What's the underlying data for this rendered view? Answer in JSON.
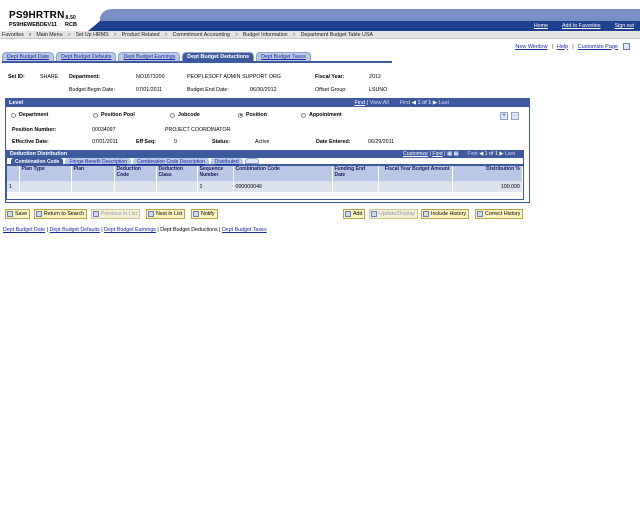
{
  "header": {
    "app_name": "PS9HRTRN",
    "version": "8.50",
    "server": "PS9HEWEBDEV11",
    "user": "RCB",
    "links": [
      "Home",
      "Add to Favorites",
      "Sign out"
    ]
  },
  "menu": [
    "Favorites",
    "Main Menu",
    "Set Up HRMS",
    "Product Related",
    "Commitment Accounting",
    "Budget Information",
    "Department Budget Table USA"
  ],
  "page_links": {
    "new_window": "New Window",
    "help": "Help",
    "customize": "Customize Page"
  },
  "tabs": [
    {
      "label": "Dept Budget Date",
      "active": false
    },
    {
      "label": "Dept Budget Defaults",
      "active": false
    },
    {
      "label": "Dept Budget Earnings",
      "active": false
    },
    {
      "label": "Dept Budget Deductions",
      "active": true
    },
    {
      "label": "Dept Budget Taxes",
      "active": false
    }
  ],
  "fields": {
    "setid_label": "Set ID:",
    "setid": "SHARE",
    "dept_label": "Department:",
    "dept": "NO1673200",
    "dept_name": "PEOPLESOFT ADMIN SUPPORT ORG",
    "fy_label": "Fiscal Year:",
    "fy": "2012",
    "bbd_label": "Budget Begin Date:",
    "bbd": "07/01/2011",
    "bed_label": "Budget End Date:",
    "bed": "06/30/2012",
    "og_label": "Offset Group:",
    "og": "LSUNO"
  },
  "level": {
    "title": "Level",
    "find": "Find",
    "view_all": "View All",
    "first": "First",
    "count": "1 of 1",
    "last": "Last",
    "options": [
      "Department",
      "Position Pool",
      "Jobcode",
      "Position",
      "Appointment"
    ],
    "selected": "Position",
    "posnum_label": "Position Number:",
    "posnum": "00034097",
    "pos_title": "PROJECT COORDINATOR",
    "eff_label": "Effective Date:",
    "eff": "07/01/2011",
    "seq_label": "Eff Seq:",
    "seq": "0",
    "status_label": "Status:",
    "status": "Active",
    "entered_label": "Date Entered:",
    "entered": "06/29/2011"
  },
  "dist": {
    "title": "Deduction Distribution",
    "customize": "Customize",
    "find": "Find",
    "first": "First",
    "count": "1 of 1",
    "last": "Last",
    "subtabs": [
      "Combination Code",
      "Fringe Benefit Description",
      "Combination Code Description",
      "Distributed"
    ],
    "columns": [
      "",
      "Plan Type",
      "Plan",
      "Deduction Code",
      "Deduction Class",
      "Sequence Number",
      "Combination Code",
      "Funding End Date",
      "Fiscal Year Budget Amount",
      "Distribution %"
    ],
    "rows": [
      [
        "1",
        "",
        "",
        "",
        "",
        "1",
        "000000046",
        "",
        "",
        "100.000"
      ]
    ]
  },
  "buttons": {
    "save": "Save",
    "return": "Return to Search",
    "prev": "Previous in List",
    "next": "Next in List",
    "notify": "Notify",
    "add": "Add",
    "update": "Update/Display",
    "include": "Include History",
    "correct": "Correct History"
  },
  "footer_links": [
    "Dept Budget Date",
    "Dept Budget Defaults",
    "Dept Budget Earnings",
    "Dept Budget Deductions",
    "Dept Budget Taxes"
  ]
}
